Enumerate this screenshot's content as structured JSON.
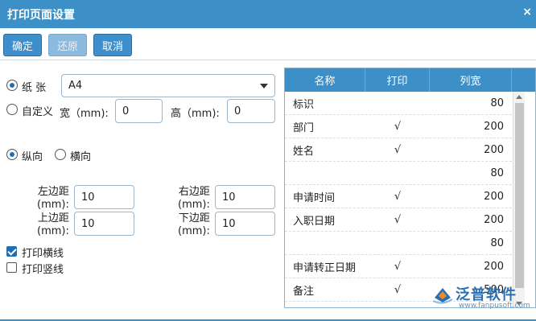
{
  "dialog": {
    "title": "打印页面设置",
    "close_glyph": "×"
  },
  "toolbar": {
    "confirm": "确定",
    "restore": "还原",
    "cancel": "取消"
  },
  "paper": {
    "label": "纸 张",
    "selected": "A4",
    "custom_label": "自定义",
    "width_label": "宽（mm):",
    "width_value": "0",
    "height_label": "高（mm):",
    "height_value": "0"
  },
  "orientation": {
    "portrait": "纵向",
    "landscape": "横向",
    "selected": "portrait"
  },
  "margins": {
    "left_label": "左边距\n(mm):",
    "left_value": "10",
    "right_label": "右边距\n(mm):",
    "right_value": "10",
    "top_label": "上边距\n(mm):",
    "top_value": "10",
    "bottom_label": "下边距\n(mm):",
    "bottom_value": "10"
  },
  "options": {
    "h_lines": "打印横线",
    "h_lines_checked": true,
    "v_lines": "打印竖线",
    "v_lines_checked": false
  },
  "grid": {
    "headers": [
      "名称",
      "打印",
      "列宽"
    ],
    "rows": [
      {
        "name": "标识",
        "print": "",
        "width": "80"
      },
      {
        "name": "部门",
        "print": "√",
        "width": "200"
      },
      {
        "name": "姓名",
        "print": "√",
        "width": "200"
      },
      {
        "name": "",
        "print": "",
        "width": "80"
      },
      {
        "name": "申请时间",
        "print": "√",
        "width": "200"
      },
      {
        "name": "入职日期",
        "print": "√",
        "width": "200"
      },
      {
        "name": "",
        "print": "",
        "width": "80"
      },
      {
        "name": "申请转正日期",
        "print": "√",
        "width": "200"
      },
      {
        "name": "备注",
        "print": "√",
        "width": "500"
      }
    ]
  },
  "watermark": {
    "brand": "泛普软件",
    "url": "www.fanpusoft.com"
  },
  "colors": {
    "header_blue": "#3c8fc7",
    "button_blue": "#3e8ecb"
  }
}
